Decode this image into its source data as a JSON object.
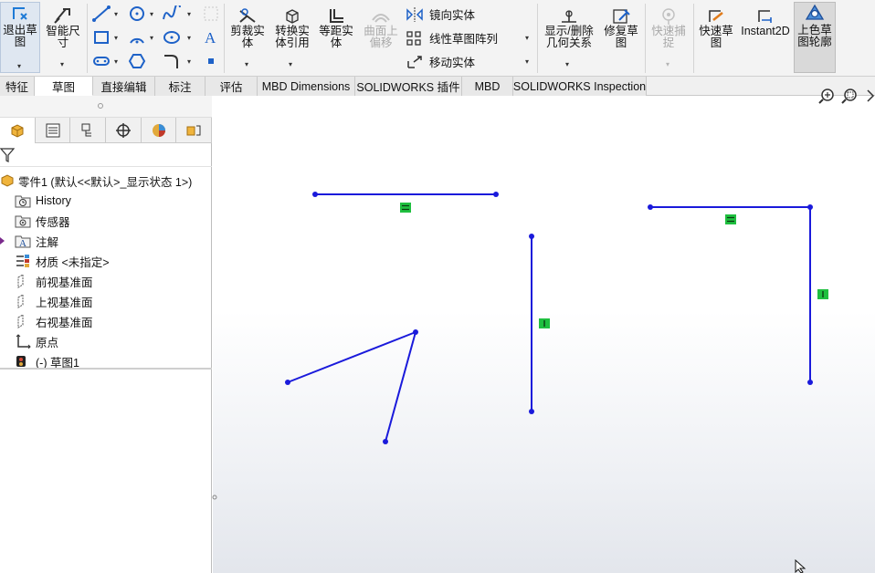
{
  "ribbon": {
    "exit_sketch": "退出草\n图",
    "smart_dimension": "智能尺\n寸",
    "trim_entities": "剪裁实\n体",
    "convert_entities": "转换实\n体引用",
    "offset_entities": "等距实\n体",
    "offset_on_surface": "曲面上\n偏移",
    "mirror_entities": "镜向实体",
    "linear_pattern": "线性草图阵列",
    "move_entities": "移动实体",
    "display_delete_relations": "显示/删除\n几何关系",
    "repair_sketch": "修复草\n图",
    "quick_snaps": "快速捕\n捉",
    "rapid_sketch": "快速草\n图",
    "instant2d": "Instant2D",
    "shaded_contours": "上色草\n图轮廓"
  },
  "tabs": [
    {
      "label": "特征"
    },
    {
      "label": "草图"
    },
    {
      "label": "直接编辑"
    },
    {
      "label": "标注"
    },
    {
      "label": "评估"
    },
    {
      "label": "MBD Dimensions"
    },
    {
      "label": "SOLIDWORKS 插件"
    },
    {
      "label": "MBD"
    },
    {
      "label": "SOLIDWORKS Inspection"
    }
  ],
  "tree": {
    "root": "零件1  (默认<<默认>_显示状态 1>)",
    "items": [
      {
        "label": "History",
        "icon": "history-folder-icon"
      },
      {
        "label": "传感器",
        "icon": "sensor-folder-icon"
      },
      {
        "label": "注解",
        "icon": "annotations-icon"
      },
      {
        "label": "材质 <未指定>",
        "icon": "material-icon"
      },
      {
        "label": "前视基准面",
        "icon": "plane-icon"
      },
      {
        "label": "上视基准面",
        "icon": "plane-icon"
      },
      {
        "label": "右视基准面",
        "icon": "plane-icon"
      },
      {
        "label": "原点",
        "icon": "origin-icon"
      },
      {
        "label": "(-) 草图1",
        "icon": "sketch-icon"
      }
    ]
  },
  "colors": {
    "sketch_line": "#1a1adb",
    "relation_badge": "#1fbf3f",
    "active_tab": "#ffffff"
  }
}
